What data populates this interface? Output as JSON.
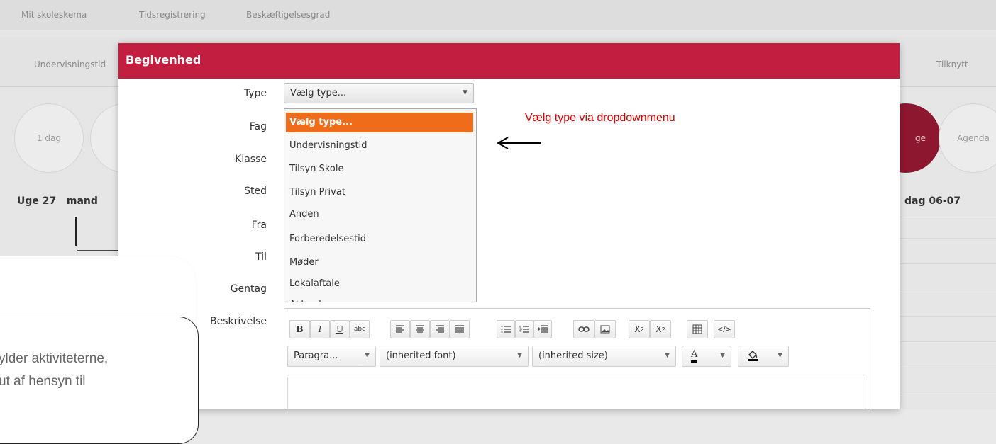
{
  "background": {
    "top_tabs": [
      "Mit skoleskema",
      "Tidsregistrering",
      "Beskæftigelsesgrad"
    ],
    "nav_left": "Undervisningstid",
    "nav_right": "Tilknytt",
    "circles": [
      "1 dag",
      "ge",
      "Agenda"
    ],
    "week_label": "Uge 27   mand",
    "week_right": "dag 06-07"
  },
  "modal": {
    "title": "Begivenhed",
    "labels": {
      "type": "Type",
      "fag": "Fag",
      "klasse": "Klasse",
      "sted": "Sted",
      "fra": "Fra",
      "til": "Til",
      "gentag": "Gentag",
      "beskrivelse": "Beskrivelse"
    },
    "type_select": {
      "value": "Vælg type..."
    },
    "type_options": [
      "Vælg type...",
      "Undervisningstid",
      "Tilsyn Skole",
      "Tilsyn Privat",
      "Anden",
      "Forberedelsestid",
      "Møder",
      "Lokalaftale",
      "Akkordopgaver"
    ],
    "selected_option_index": 0
  },
  "annotation": {
    "text": "Vælg type via dropdownmenu",
    "color": "#e00000"
  },
  "editor": {
    "format_buttons": [
      "B",
      "I",
      "U",
      "abc"
    ],
    "paragraph": "Paragra...",
    "font": "(inherited font)",
    "size": "(inherited size)",
    "text_color_label": "A"
  },
  "tooltip": {
    "line1": "ylder aktiviteterne,",
    "line2": "ut af hensyn til"
  },
  "colors": {
    "header": "#c21e3f",
    "selected_option": "#ef6d1a"
  }
}
